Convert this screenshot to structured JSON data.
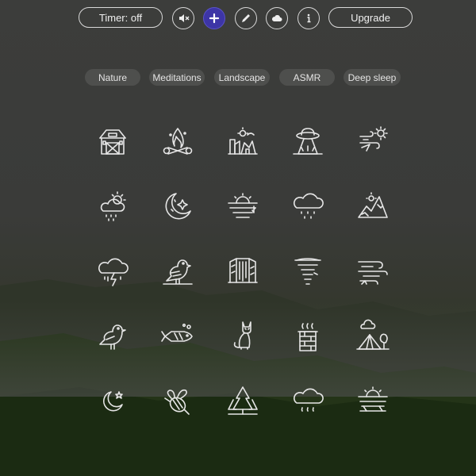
{
  "toolbar": {
    "timer_label": "Timer: off",
    "upgrade_label": "Upgrade",
    "icons": [
      "speaker-muted-icon",
      "plus-icon",
      "pencil-icon",
      "cloud-icon",
      "info-icon"
    ]
  },
  "categories": [
    "Nature",
    "Meditations",
    "Landscape",
    "ASMR",
    "Deep sleep"
  ],
  "sounds": [
    "barn-icon",
    "campfire-icon",
    "city-icon",
    "ufo-icon",
    "wind-sun-icon",
    "sun-rain-cloud-icon",
    "moon-stars-icon",
    "sunset-water-icon",
    "rain-cloud-icon",
    "mountain-sun-icon",
    "thunderstorm-icon",
    "bird-icon",
    "waterfall-icon",
    "tornado-icon",
    "wind-lines-icon",
    "songbird-icon",
    "fish-icon",
    "cat-icon",
    "chimney-smoke-icon",
    "tent-camping-icon",
    "crescent-moon-star-icon",
    "bee-icon",
    "forest-trees-icon",
    "light-rain-cloud-icon",
    "beach-sunset-icon"
  ],
  "colors": {
    "accent": "#3d35a6",
    "icon": "#e6e6e6"
  }
}
